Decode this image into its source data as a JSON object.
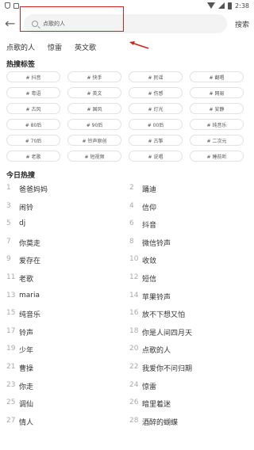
{
  "status": {
    "time": "2:38"
  },
  "search": {
    "value": "点歌的人",
    "button": "搜索"
  },
  "history": [
    "点歌的人",
    "惊雷",
    "英文歌"
  ],
  "hot_tags": {
    "title": "热搜标签",
    "items": [
      "# 抖音",
      "# 快手",
      "# 民谣",
      "# 翻唱",
      "# 粤语",
      "# 英文",
      "# 伤感",
      "# 网易",
      "# 古风",
      "# 国风",
      "# 灯光",
      "# 安静",
      "# 80后",
      "# 90后",
      "# 00后",
      "# 纯音乐",
      "# 70后",
      "# 铃声原创",
      "# 古筝",
      "# 二次元",
      "# 老歌",
      "# 短视频",
      "# 说唱",
      "# 睡前听"
    ]
  },
  "hot_search": {
    "title": "今日热搜",
    "items": [
      {
        "rank": "1",
        "title": "爸爸妈妈"
      },
      {
        "rank": "2",
        "title": "踊迪"
      },
      {
        "rank": "3",
        "title": "闹铃"
      },
      {
        "rank": "4",
        "title": "信仰"
      },
      {
        "rank": "5",
        "title": "dj"
      },
      {
        "rank": "6",
        "title": "抖音"
      },
      {
        "rank": "7",
        "title": "你莫走"
      },
      {
        "rank": "8",
        "title": "微信铃声"
      },
      {
        "rank": "9",
        "title": "爱存在"
      },
      {
        "rank": "10",
        "title": "收敛"
      },
      {
        "rank": "11",
        "title": "老歌"
      },
      {
        "rank": "12",
        "title": "短信"
      },
      {
        "rank": "13",
        "title": "maria"
      },
      {
        "rank": "14",
        "title": "苹果铃声"
      },
      {
        "rank": "15",
        "title": "纯音乐"
      },
      {
        "rank": "16",
        "title": "放不下想又怕"
      },
      {
        "rank": "17",
        "title": "铃声"
      },
      {
        "rank": "18",
        "title": "你是人间四月天"
      },
      {
        "rank": "19",
        "title": "少年"
      },
      {
        "rank": "20",
        "title": "点歌的人"
      },
      {
        "rank": "21",
        "title": "曹操"
      },
      {
        "rank": "22",
        "title": "我爱你不问归期"
      },
      {
        "rank": "23",
        "title": "你走"
      },
      {
        "rank": "24",
        "title": "惊雷"
      },
      {
        "rank": "25",
        "title": "调仙"
      },
      {
        "rank": "26",
        "title": "暗里着迷"
      },
      {
        "rank": "27",
        "title": "情人"
      },
      {
        "rank": "28",
        "title": "酒醉的蝴蝶"
      }
    ]
  }
}
